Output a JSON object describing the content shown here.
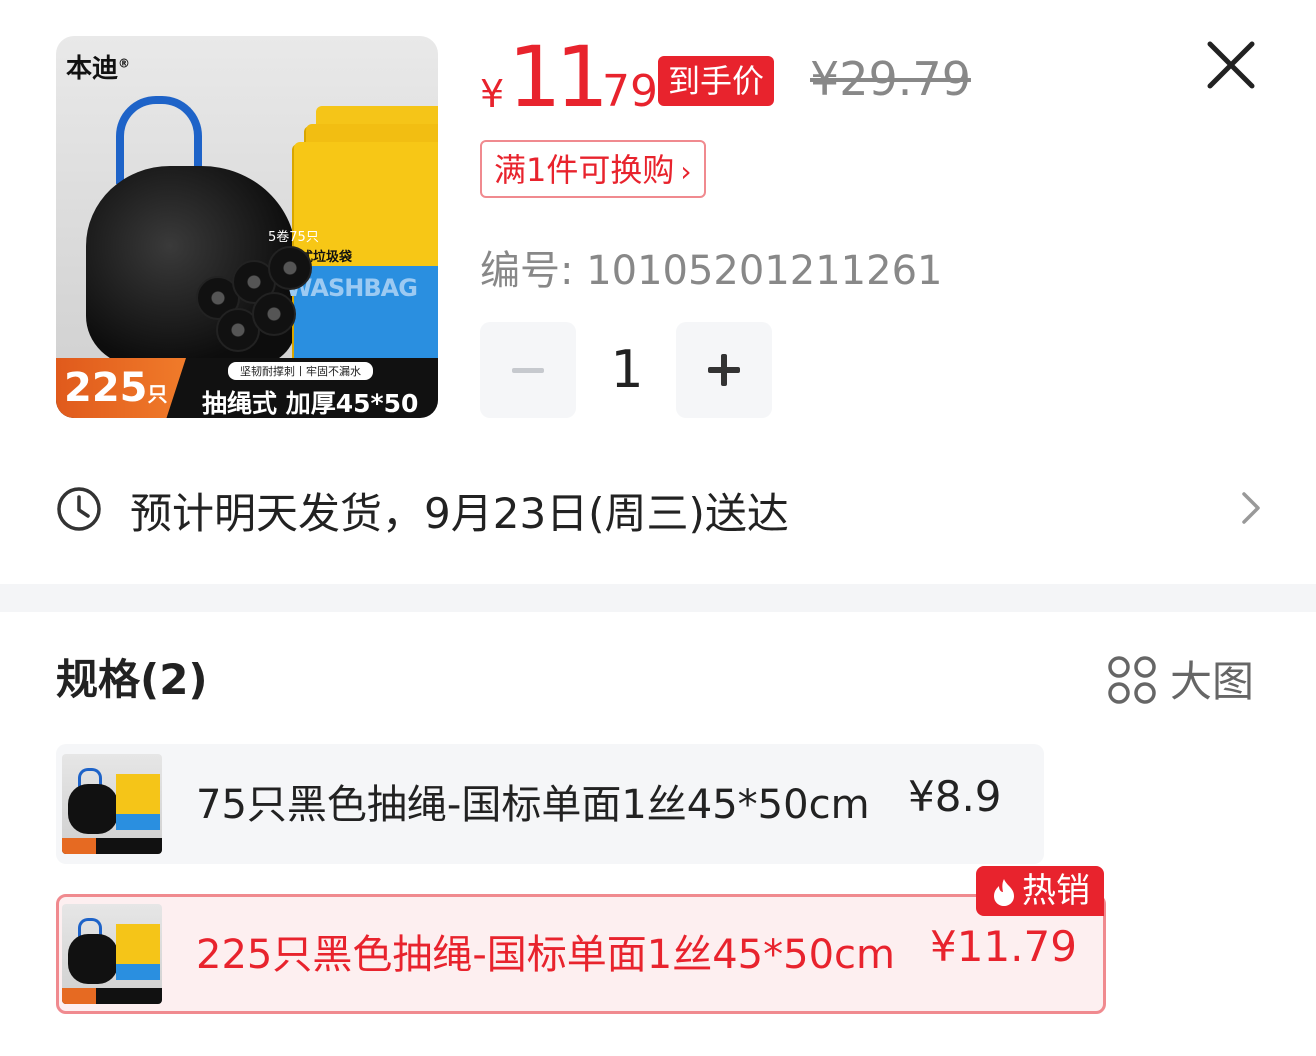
{
  "product": {
    "thumb": {
      "brand": "本迪",
      "brand_mark": "®",
      "box_count": "5卷75只",
      "box_name": "抽绳式垃圾袋",
      "box_en": "WASHBAG",
      "count": "225",
      "count_unit": "只",
      "pill": "坚韧耐撑刺丨牢固不漏水",
      "desc": "抽绳式 加厚45*50"
    },
    "price": {
      "currency": "¥",
      "integer": "11",
      "decimal": ".79",
      "net_label": "到手价",
      "original": "¥29.79"
    },
    "exchange_tag": "满1件可换购",
    "sku_code": "编号: 10105201211261",
    "quantity": "1"
  },
  "delivery": {
    "text": "预计明天发货，9月23日(周三)送达"
  },
  "spec": {
    "title": "规格(2)",
    "bigview_label": "大图",
    "options": [
      {
        "label": "75只黑色抽绳-国标单面1丝45*50cm",
        "price": "¥8.9",
        "selected": false
      },
      {
        "label": "225只黑色抽绳-国标单面1丝45*50cm",
        "price": "¥11.79",
        "selected": true,
        "badge": "热销"
      }
    ]
  },
  "colors": {
    "accent_red": "#e8232d",
    "selected_bg": "#fdeff0",
    "option_bg": "#f5f6f8"
  },
  "icons": [
    "close-icon",
    "minus-icon",
    "plus-icon",
    "clock-icon",
    "chevron-right-icon",
    "grid-icon",
    "flame-icon"
  ]
}
